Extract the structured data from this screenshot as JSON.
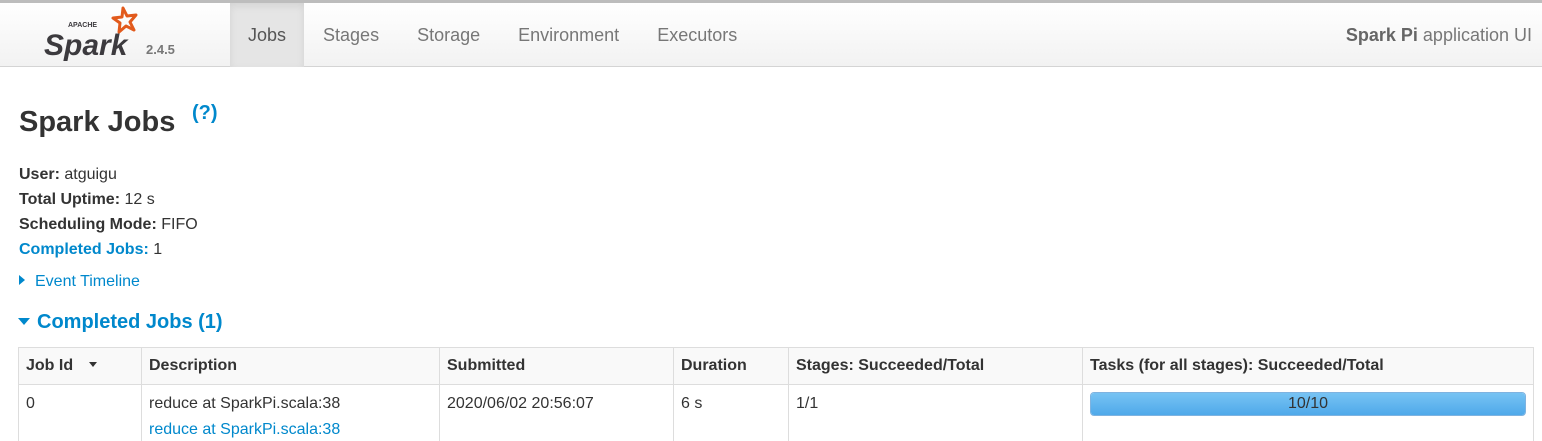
{
  "navbar": {
    "logo_text": "Spark",
    "logo_small_text": "APACHE",
    "version": "2.4.5",
    "tabs": [
      {
        "label": "Jobs",
        "active": true
      },
      {
        "label": "Stages",
        "active": false
      },
      {
        "label": "Storage",
        "active": false
      },
      {
        "label": "Environment",
        "active": false
      },
      {
        "label": "Executors",
        "active": false
      }
    ],
    "app_name": "Spark Pi",
    "app_suffix": " application UI",
    "logo_color": "#e25a1c"
  },
  "page": {
    "title": "Spark Jobs",
    "help": "(?)"
  },
  "summary": {
    "user_label": "User:",
    "user_value": " atguigu",
    "uptime_label": "Total Uptime:",
    "uptime_value": " 12 s",
    "scheduling_label": "Scheduling Mode:",
    "scheduling_value": " FIFO",
    "completed_label": "Completed Jobs:",
    "completed_value": " 1"
  },
  "event_timeline": {
    "label": "Event Timeline",
    "icon": "triangle-right-icon"
  },
  "completed_section": {
    "label": "Completed Jobs (1)",
    "icon": "triangle-down-icon"
  },
  "table": {
    "headers": [
      "Job Id",
      "Description",
      "Submitted",
      "Duration",
      "Stages: Succeeded/Total",
      "Tasks (for all stages): Succeeded/Total"
    ],
    "rows": [
      {
        "job_id": "0",
        "description": "reduce at SparkPi.scala:38",
        "description_link": "reduce at SparkPi.scala:38",
        "submitted": "2020/06/02 20:56:07",
        "duration": "6 s",
        "stages": "1/1",
        "tasks_label": "10/10",
        "tasks_progress": 1.0
      }
    ]
  },
  "colors": {
    "link": "#0088cc",
    "progress": "#5fb4ee"
  }
}
